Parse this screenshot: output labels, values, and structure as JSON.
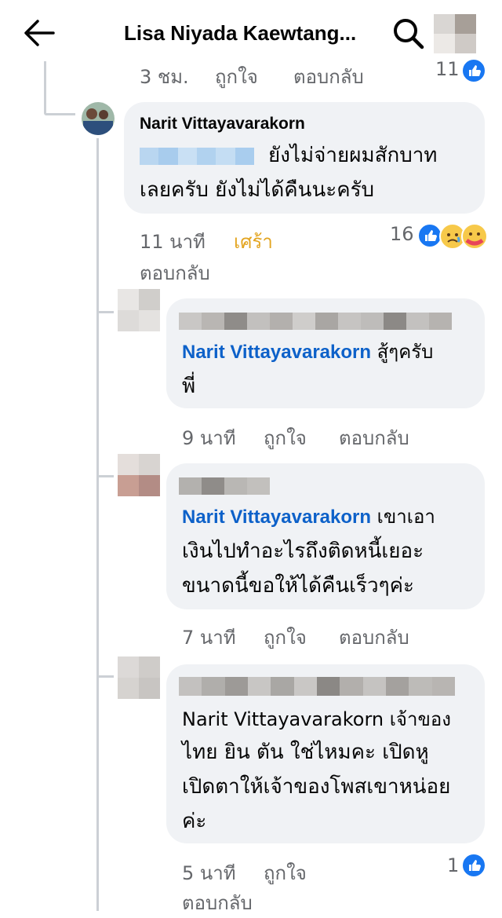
{
  "header": {
    "title": "Lisa Niyada Kaewtang...",
    "back_icon": "arrow-left-icon",
    "search_icon": "search-icon"
  },
  "top_meta": {
    "time": "3 ชม.",
    "like": "ถูกใจ",
    "reply": "ตอบกลับ",
    "reaction_count": "11"
  },
  "comments": [
    {
      "author": "Narit Vittayavarakorn",
      "line1": "ยังไม่จ่ายผมสักบาท",
      "line2": "เลยครับ ยังไม่ได้คืนนะครับ",
      "time": "11 นาที",
      "reaction_label": "เศร้า",
      "reply": "ตอบกลับ",
      "reaction_count": "16",
      "reactions": [
        "like-icon",
        "sad-icon",
        "care-icon"
      ]
    },
    {
      "mention": "Narit Vittayavarakorn",
      "text_after": "สู้ๆครับ",
      "line2": "พี่",
      "time": "9 นาที",
      "like": "ถูกใจ",
      "reply": "ตอบกลับ"
    },
    {
      "mention": "Narit Vittayavarakorn",
      "text_after": "เขาเอา",
      "line2": "เงินไปทำอะไรถึงติดหนี้เยอะ",
      "line3": "ขนาดนี้ขอให้ได้คืนเร็วๆค่ะ",
      "time": "7 นาที",
      "like": "ถูกใจ",
      "reply": "ตอบกลับ"
    },
    {
      "line1": "Narit Vittayavarakorn เจ้าของ",
      "line2": "ไทย ยิน ตัน ใช่ไหมคะ เปิดหู",
      "line3": "เปิดตาให้เจ้าของโพสเขาหน่อย",
      "line4": "ค่ะ",
      "time": "5 นาที",
      "like": "ถูกใจ",
      "reply": "ตอบกลับ",
      "reaction_count": "1"
    }
  ],
  "colors": {
    "bubble": "#f0f2f5",
    "mention": "#0d61c9",
    "meta": "#65676b",
    "sad_reaction_label": "#e3a521",
    "like_blue": "#1877f2"
  }
}
